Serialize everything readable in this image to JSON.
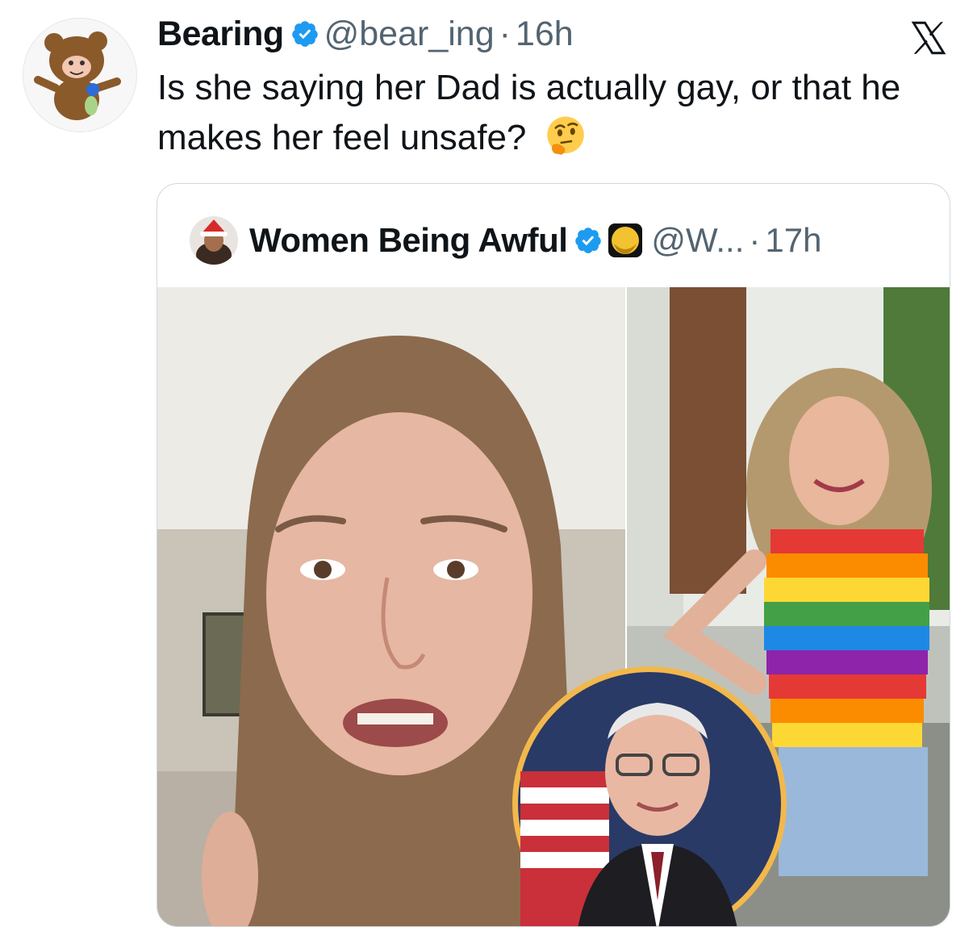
{
  "tweet": {
    "author_name": "Bearing",
    "handle": "@bear_ing",
    "separator": "·",
    "time": "16h",
    "text": "Is she saying her Dad is actually gay, or that he makes her feel unsafe?",
    "emoji": "thinking-face"
  },
  "quoted_tweet": {
    "author_name": "Women Being Awful",
    "handle": "@W...",
    "separator": "·",
    "time": "17h",
    "media": {
      "description_icons": [
        "verified-badge-icon",
        "gold-orb-icon"
      ]
    }
  },
  "colors": {
    "verified_blue": "#1d9bf0",
    "text_primary": "#0f1419",
    "text_secondary": "#536471",
    "border": "#cfd9de",
    "orb_gold": "#f2c230"
  },
  "icons": {
    "platform_logo": "x-logo-icon",
    "verified": "verified-badge-icon"
  }
}
